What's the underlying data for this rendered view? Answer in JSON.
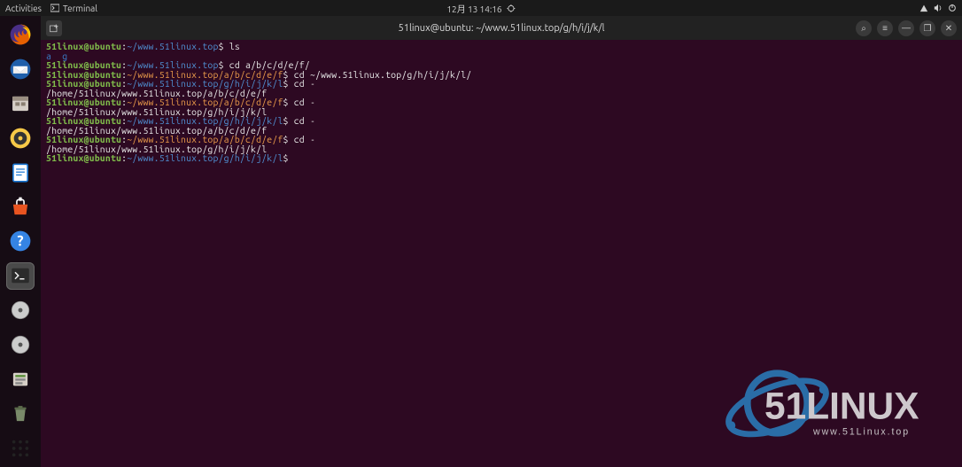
{
  "topbar": {
    "activities": "Activities",
    "app_name": "Terminal",
    "datetime": "12月 13 14:16"
  },
  "dock": {
    "items": [
      "firefox-icon",
      "thunderbird-icon",
      "files-icon",
      "rhythmbox-icon",
      "libreoffice-writer-icon",
      "ubuntu-software-icon",
      "help-icon",
      "terminal-icon",
      "disc-icon",
      "disc-icon",
      "additional-drivers-icon",
      "trash-icon"
    ],
    "apps_label": "Show Applications"
  },
  "window": {
    "title": "51linux@ubuntu: ~/www.51linux.top/g/h/i/j/k/l",
    "buttons": {
      "search": "⌕",
      "menu": "≡",
      "minimize": "—",
      "restore": "❐",
      "close": "✕"
    }
  },
  "terminal": {
    "user_host": "51linux@ubuntu",
    "lines": [
      {
        "path": "~/www.51linux.top",
        "cmd": "ls"
      },
      {
        "ls_out": [
          "a",
          "g"
        ]
      },
      {
        "path": "~/www.51linux.top",
        "cmd": "cd a/b/c/d/e/f/"
      },
      {
        "path_orange": "~/www.51linux.top/a/b/c/d/e/f",
        "cmd": "cd ~/www.51linux.top/g/h/i/j/k/l/"
      },
      {
        "path": "~/www.51linux.top/g/h/i/j/k/l",
        "cmd": "cd -"
      },
      {
        "plain": "/home/51linux/www.51linux.top/a/b/c/d/e/f"
      },
      {
        "path_orange": "~/www.51linux.top/a/b/c/d/e/f",
        "cmd": "cd -"
      },
      {
        "plain": "/home/51linux/www.51linux.top/g/h/i/j/k/l"
      },
      {
        "path": "~/www.51linux.top/g/h/i/j/k/l",
        "cmd": "cd -"
      },
      {
        "plain": "/home/51linux/www.51linux.top/a/b/c/d/e/f"
      },
      {
        "path_orange": "~/www.51linux.top/a/b/c/d/e/f",
        "cmd": "cd -"
      },
      {
        "plain": "/home/51linux/www.51linux.top/g/h/i/j/k/l"
      },
      {
        "path": "~/www.51linux.top/g/h/i/j/k/l",
        "cmd": ""
      }
    ]
  },
  "watermark": {
    "brand": "51LINUX",
    "url": "www.51Linux.top"
  }
}
